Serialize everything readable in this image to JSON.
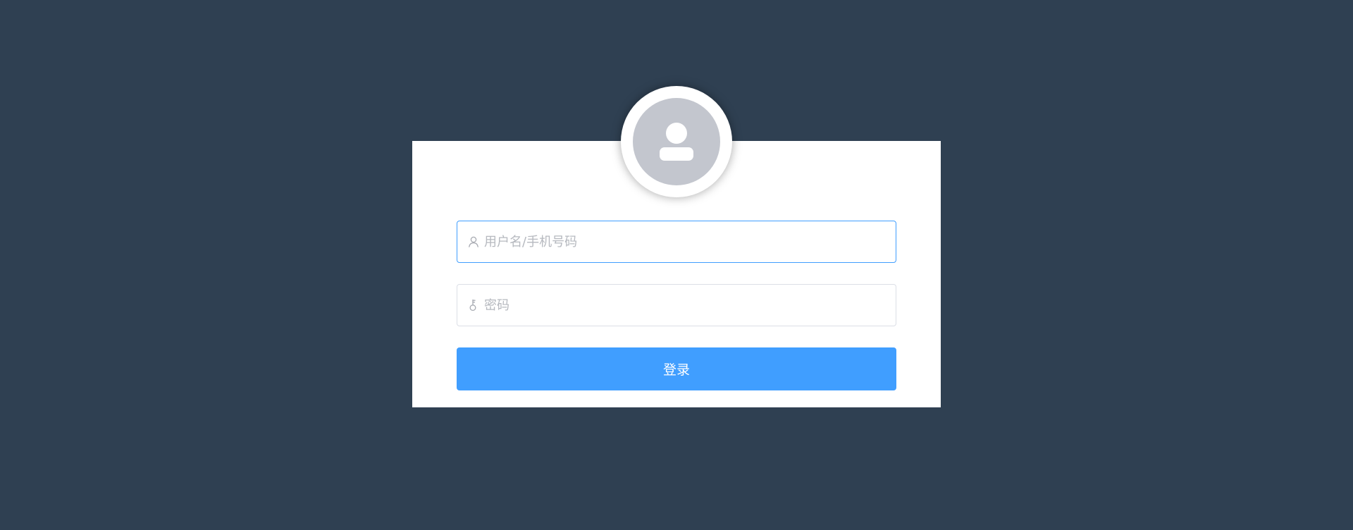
{
  "login": {
    "username": {
      "placeholder": "用户名/手机号码",
      "value": "",
      "icon": "user-icon"
    },
    "password": {
      "placeholder": "密码",
      "value": "",
      "icon": "key-icon"
    },
    "submit_label": "登录"
  },
  "avatar": {
    "icon": "user-avatar-icon"
  },
  "colors": {
    "background": "#2f4052",
    "card": "#ffffff",
    "primary": "#409eff",
    "avatar_bg": "#c3c6ce",
    "input_border": "#dcdfe6",
    "placeholder": "#b6b9bf"
  }
}
